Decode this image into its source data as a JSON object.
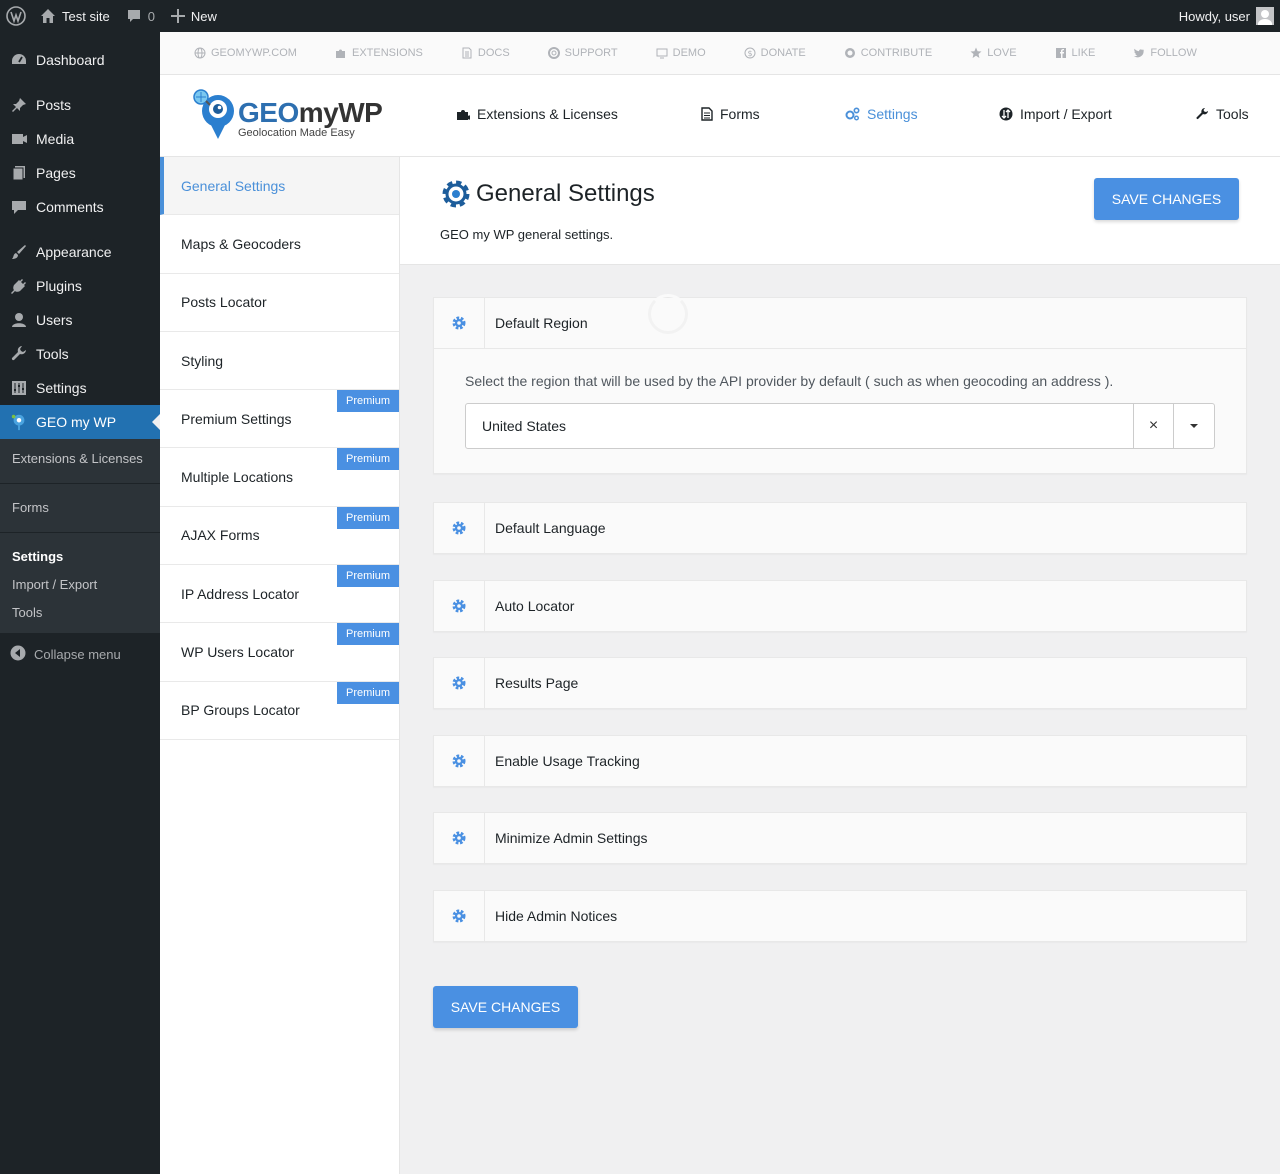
{
  "adminbar": {
    "site_name": "Test site",
    "comments_count": "0",
    "new_label": "New",
    "howdy": "Howdy, user"
  },
  "menu": {
    "items": [
      {
        "label": "Dashboard",
        "icon": "dashboard-icon"
      },
      {
        "label": "Posts",
        "icon": "pin-icon"
      },
      {
        "label": "Media",
        "icon": "media-icon"
      },
      {
        "label": "Pages",
        "icon": "pages-icon"
      },
      {
        "label": "Comments",
        "icon": "comment-icon"
      },
      {
        "label": "Appearance",
        "icon": "brush-icon"
      },
      {
        "label": "Plugins",
        "icon": "plug-icon"
      },
      {
        "label": "Users",
        "icon": "user-icon"
      },
      {
        "label": "Tools",
        "icon": "wrench-icon"
      },
      {
        "label": "Settings",
        "icon": "sliders-icon"
      },
      {
        "label": "GEO my WP",
        "icon": "geomywp-icon"
      }
    ],
    "submenu": [
      "Extensions & Licenses",
      "Forms",
      "Settings",
      "Import / Export",
      "Tools"
    ],
    "collapse": "Collapse menu"
  },
  "toplinks": [
    {
      "label": "GEOMYWP.COM",
      "icon": "globe-icon"
    },
    {
      "label": "EXTENSIONS",
      "icon": "puzzle-icon"
    },
    {
      "label": "DOCS",
      "icon": "doc-icon"
    },
    {
      "label": "SUPPORT",
      "icon": "lifebuoy-icon"
    },
    {
      "label": "DEMO",
      "icon": "monitor-icon"
    },
    {
      "label": "DONATE",
      "icon": "dollar-icon"
    },
    {
      "label": "CONTRIBUTE",
      "icon": "github-icon"
    },
    {
      "label": "LOVE",
      "icon": "star-icon"
    },
    {
      "label": "LIKE",
      "icon": "facebook-icon"
    },
    {
      "label": "FOLLOW",
      "icon": "twitter-icon"
    }
  ],
  "logo": {
    "geo": "GEO",
    "rest": "myWP",
    "tagline": "Geolocation Made Easy"
  },
  "header_nav": [
    {
      "label": "Extensions & Licenses",
      "icon": "puzzle-icon"
    },
    {
      "label": "Forms",
      "icon": "doc-icon"
    },
    {
      "label": "Settings",
      "icon": "cogs-icon"
    },
    {
      "label": "Import / Export",
      "icon": "import-export-icon"
    },
    {
      "label": "Tools",
      "icon": "wrench-icon"
    }
  ],
  "tabs": [
    {
      "label": "General Settings",
      "premium": false
    },
    {
      "label": "Maps & Geocoders",
      "premium": false
    },
    {
      "label": "Posts Locator",
      "premium": false
    },
    {
      "label": "Styling",
      "premium": false
    },
    {
      "label": "Premium Settings",
      "premium": true
    },
    {
      "label": "Multiple Locations",
      "premium": true
    },
    {
      "label": "AJAX Forms",
      "premium": true
    },
    {
      "label": "IP Address Locator",
      "premium": true
    },
    {
      "label": "WP Users Locator",
      "premium": true
    },
    {
      "label": "BP Groups Locator",
      "premium": true
    }
  ],
  "premium_label": "Premium",
  "page": {
    "title": "General Settings",
    "description": "GEO my WP general settings.",
    "save_label": "SAVE CHANGES"
  },
  "panels": {
    "default_region": {
      "title": "Default Region",
      "description": "Select the region that will be used by the API provider by default ( such as when geocoding an address ).",
      "value": "United States",
      "clear": "×"
    },
    "others": [
      "Default Language",
      "Auto Locator",
      "Results Page",
      "Enable Usage Tracking",
      "Minimize Admin Settings",
      "Hide Admin Notices"
    ]
  },
  "colors": {
    "accent": "#4a90e2",
    "admin_dark": "#1d2327",
    "wp_blue": "#2271b1"
  }
}
